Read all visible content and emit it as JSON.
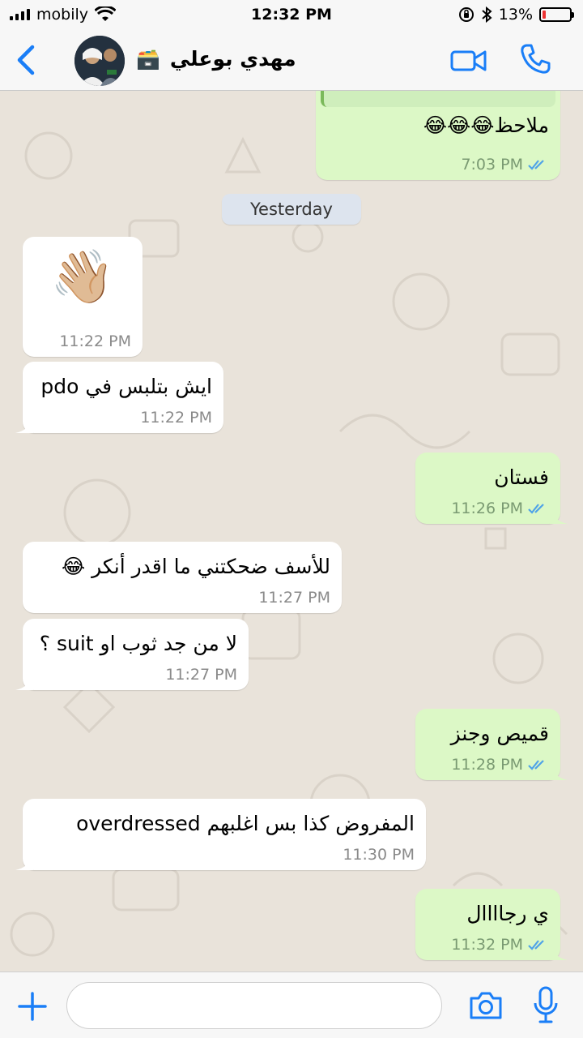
{
  "status_bar": {
    "carrier": "mobily",
    "time": "12:32 PM",
    "battery": "13%",
    "battery_level": 0.13
  },
  "header": {
    "contact_name": "مهدي بوعلي",
    "contact_emoji": "🗃️"
  },
  "chat": {
    "date_divider": "Yesterday",
    "messages": [
      {
        "direction": "out",
        "text": "ملاحظ😂😂😂",
        "time": "7:03 PM"
      },
      {
        "direction": "in",
        "text": "👋🏼",
        "time": "11:22 PM"
      },
      {
        "direction": "in",
        "text": "ايش بتلبس في pdo",
        "time": "11:22 PM"
      },
      {
        "direction": "out",
        "text": "فستان",
        "time": "11:26 PM"
      },
      {
        "direction": "in",
        "text": "للأسف ضحكتني ما اقدر أنكر 😂",
        "time": "11:27 PM"
      },
      {
        "direction": "in",
        "text": "لا من جد ثوب او suit ؟",
        "time": "11:27 PM"
      },
      {
        "direction": "out",
        "text": "قميص وجنز",
        "time": "11:28 PM"
      },
      {
        "direction": "in",
        "text": "المفروض كذا بس اغلبهم overdressed",
        "time": "11:30 PM"
      },
      {
        "direction": "out",
        "text": "ي رجاااال",
        "time": "11:32 PM"
      }
    ]
  },
  "input": {
    "placeholder": ""
  },
  "icons": {
    "back": "chevron-left-icon",
    "video": "video-camera-icon",
    "call": "phone-icon",
    "plus": "plus-icon",
    "camera": "camera-icon",
    "mic": "microphone-icon",
    "read_receipt": "double-check-icon"
  },
  "colors": {
    "accent": "#1a7ef7",
    "outgoing_bubble": "#dcf8c6",
    "incoming_bubble": "#ffffff",
    "read_ticks": "#4fa3e8",
    "chat_background": "#e9e3da"
  }
}
